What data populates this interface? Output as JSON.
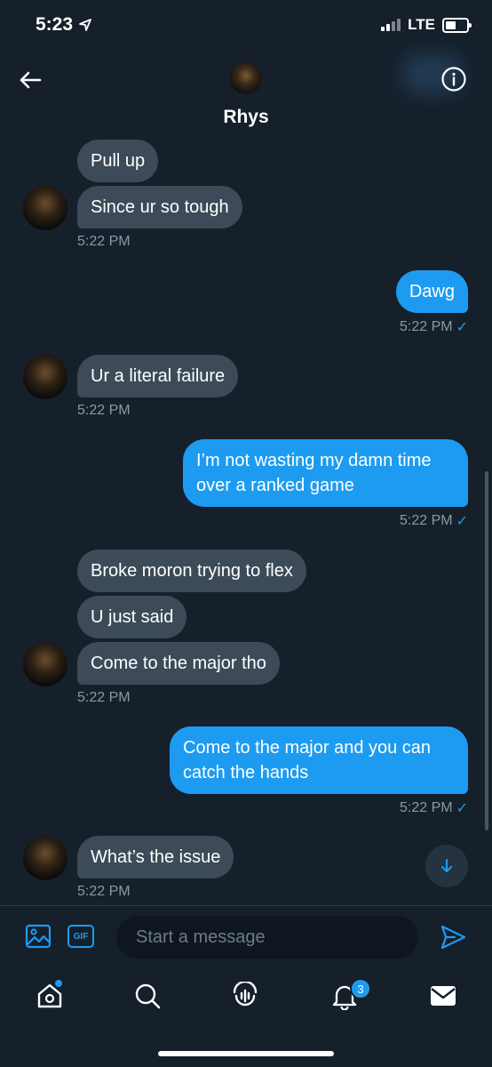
{
  "status_bar": {
    "time": "5:23",
    "network": "LTE"
  },
  "header": {
    "name": "Rhys"
  },
  "messages": {
    "m1": "Pull up",
    "m2": "Since ur so tough",
    "t1": "5:22 PM",
    "m3": "Dawg",
    "t2": "5:22 PM",
    "m4": "Ur a literal failure",
    "t3": "5:22 PM",
    "m5": "I’m not wasting my damn time over a ranked game",
    "t4": "5:22 PM",
    "m6": "Broke moron trying to flex",
    "m7": "U just said",
    "m8": "Come to the major tho",
    "t5": "5:22 PM",
    "m9": "Come to the major and you can catch the hands",
    "t6": "5:22 PM",
    "m10": "What’s the issue",
    "t7": "5:22 PM",
    "check": "✓"
  },
  "composer": {
    "placeholder": "Start a message",
    "gif_label": "GIF"
  },
  "nav": {
    "notifications_count": "3"
  },
  "icons": {
    "back": "arrow-left-icon",
    "info": "info-icon",
    "image": "image-icon",
    "gif": "gif-icon",
    "send": "send-icon",
    "home": "home-icon",
    "search": "search-icon",
    "spaces": "spaces-icon",
    "notifications": "bell-icon",
    "messages": "mail-icon"
  },
  "colors": {
    "accent": "#1d9bf0",
    "background": "#15202b",
    "received_bubble": "#3d4b59"
  }
}
